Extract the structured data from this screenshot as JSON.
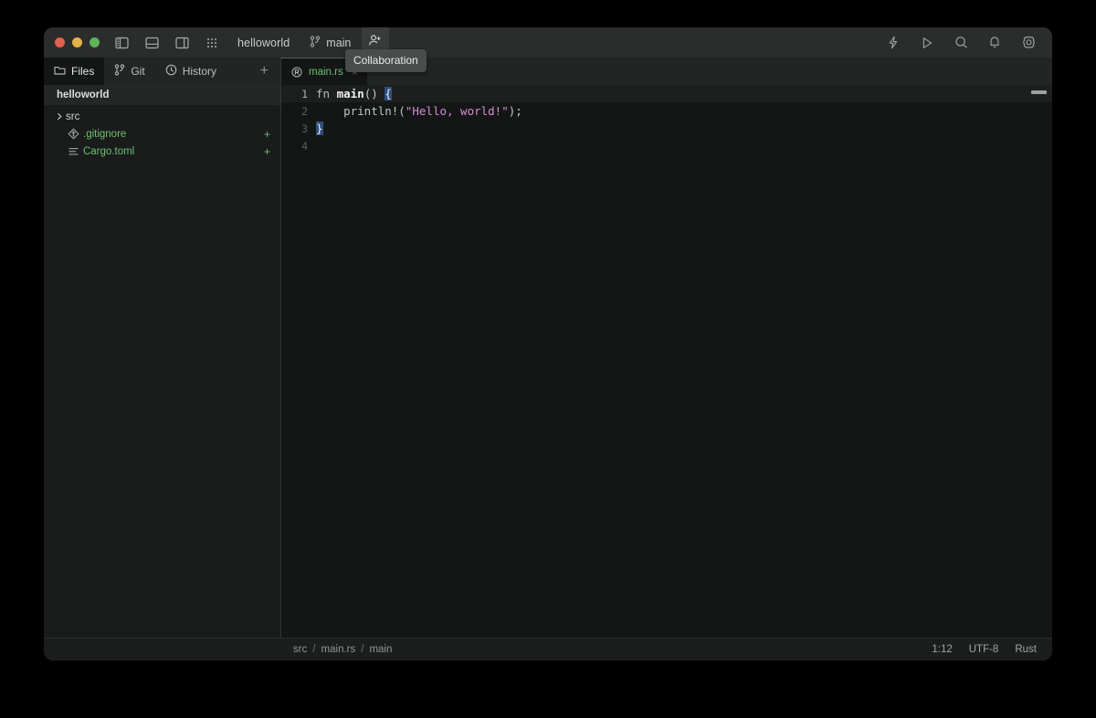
{
  "window": {
    "title": "helloworld",
    "branch": "main"
  },
  "titlebar": {
    "traffic_lights": [
      "close",
      "minimize",
      "zoom"
    ],
    "panel_icons": [
      "left-panel-icon",
      "bottom-panel-icon",
      "right-panel-icon",
      "grid-apps-icon"
    ],
    "project_label": "helloworld",
    "branch_label": "main",
    "collaboration_label": "Collaboration",
    "right_icons": [
      "zap-icon",
      "run-icon",
      "search-icon",
      "bell-icon",
      "settings-gear-icon"
    ]
  },
  "tooltip": {
    "text": "Collaboration"
  },
  "sidebar": {
    "tabs": [
      {
        "label": "Files",
        "icon": "folder-icon",
        "active": true
      },
      {
        "label": "Git",
        "icon": "git-branch-icon",
        "active": false
      },
      {
        "label": "History",
        "icon": "clock-icon",
        "active": false
      }
    ],
    "add_label": "+",
    "project_name": "helloworld",
    "tree": [
      {
        "name": "src",
        "type": "folder",
        "expanded": false,
        "chevron": "›",
        "status": "",
        "color": "default"
      },
      {
        "name": ".gitignore",
        "type": "file",
        "icon": "gitignore-icon",
        "status": "+",
        "color": "green"
      },
      {
        "name": "Cargo.toml",
        "type": "file",
        "icon": "toml-lines-icon",
        "status": "+",
        "color": "green"
      }
    ]
  },
  "editor": {
    "tabs": [
      {
        "label": "main.rs",
        "icon": "rust-logo-icon",
        "close": "×",
        "active": true
      }
    ],
    "lines": [
      {
        "number": "1",
        "active": true,
        "tokens": [
          {
            "text": "fn ",
            "type": "kw"
          },
          {
            "text": "main",
            "type": "fnname"
          },
          {
            "text": "() ",
            "type": "punct"
          },
          {
            "text": "{",
            "type": "brace-hl"
          }
        ]
      },
      {
        "number": "2",
        "active": false,
        "tokens": [
          {
            "text": "    println!(",
            "type": "macro"
          },
          {
            "text": "\"Hello, world!\"",
            "type": "string"
          },
          {
            "text": ");",
            "type": "punct"
          }
        ]
      },
      {
        "number": "3",
        "active": false,
        "tokens": [
          {
            "text": "}",
            "type": "brace-hl"
          }
        ]
      },
      {
        "number": "4",
        "active": false,
        "tokens": []
      }
    ]
  },
  "status": {
    "breadcrumb": [
      "src",
      "main.rs",
      "main"
    ],
    "separator": "/",
    "cursor": "1:12",
    "encoding": "UTF-8",
    "language": "Rust"
  },
  "colors": {
    "window_bg": "#1a1c1c",
    "titlebar_bg": "#2b2d2d",
    "editor_bg": "#141616",
    "accent_green": "#6fbf73",
    "string_pink": "#d28ed2",
    "brace_highlight": "#2d4f7c"
  }
}
